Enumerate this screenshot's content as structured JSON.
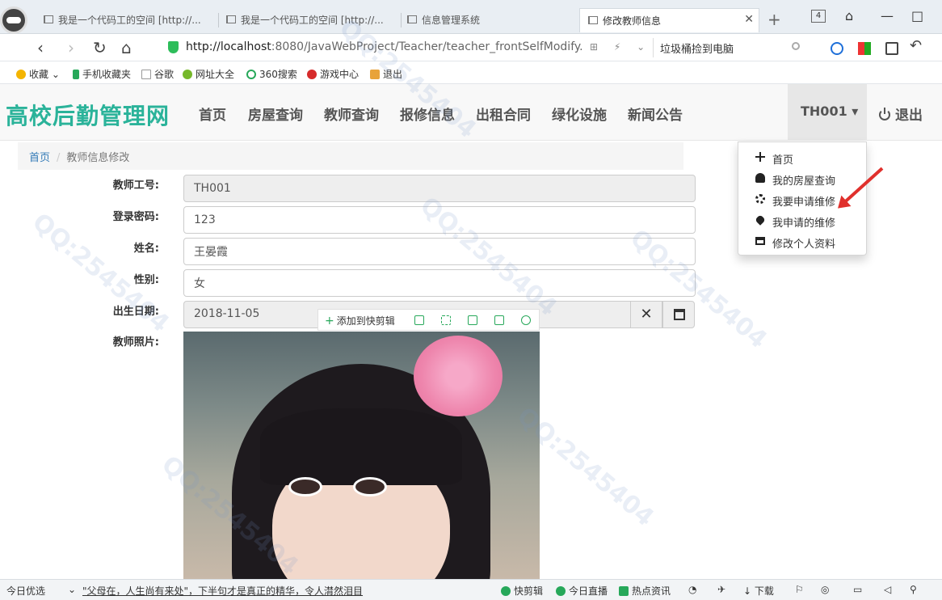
{
  "browser": {
    "tabs": [
      {
        "title": "我是一个代码工的空间 [http://..."
      },
      {
        "title": "我是一个代码工的空间 [http://..."
      },
      {
        "title": "信息管理系统"
      },
      {
        "title": "修改教师信息"
      }
    ],
    "tab_count": "4",
    "url_host": "http://localhost",
    "url_rest": ":8080/JavaWebProject/Teacher/teacher_frontSelfModify.",
    "search_text": "垃圾桶捡到电脑",
    "bookmarks": [
      {
        "label": "收藏"
      },
      {
        "label": "手机收藏夹"
      },
      {
        "label": "谷歌"
      },
      {
        "label": "网址大全"
      },
      {
        "label": "360搜索"
      },
      {
        "label": "游戏中心"
      },
      {
        "label": "退出"
      }
    ]
  },
  "site": {
    "brand": "高校后勤管理网",
    "nav": [
      {
        "label": "首页"
      },
      {
        "label": "房屋查询"
      },
      {
        "label": "教师查询"
      },
      {
        "label": "报修信息"
      },
      {
        "label": "出租合同"
      },
      {
        "label": "绿化设施"
      },
      {
        "label": "新闻公告"
      }
    ],
    "user": "TH001 ▾",
    "logout": "退出",
    "dropdown": [
      {
        "label": "首页",
        "icon": "move-icon"
      },
      {
        "label": "我的房屋查询",
        "icon": "user-icon"
      },
      {
        "label": "我要申请维修",
        "icon": "cog-icon"
      },
      {
        "label": "我申请的维修",
        "icon": "heart-icon"
      },
      {
        "label": "修改个人资料",
        "icon": "card-icon"
      }
    ]
  },
  "breadcrumb": {
    "home": "首页",
    "separator": "/",
    "current": "教师信息修改"
  },
  "form": {
    "teacher_no_label": "教师工号:",
    "teacher_no": "TH001",
    "password_label": "登录密码:",
    "password": "123",
    "name_label": "姓名:",
    "name": "王晏霞",
    "gender_label": "性别:",
    "gender": "女",
    "birth_label": "出生日期:",
    "birth": "2018-11-05",
    "photo_label": "教师照片:"
  },
  "clip_toolbar": {
    "label": "添加到快剪辑"
  },
  "statusbar": {
    "today": "今日优选",
    "news": "\"父母在，人生尚有来处\"，下半句才是真正的精华，令人潸然泪目",
    "items": [
      {
        "label": "快剪辑"
      },
      {
        "label": "今日直播"
      },
      {
        "label": "热点资讯"
      },
      {
        "label": "下载"
      }
    ]
  },
  "colors": {
    "brand": "#2bb39a",
    "link": "#337ab7",
    "arrow": "#e0302c"
  }
}
